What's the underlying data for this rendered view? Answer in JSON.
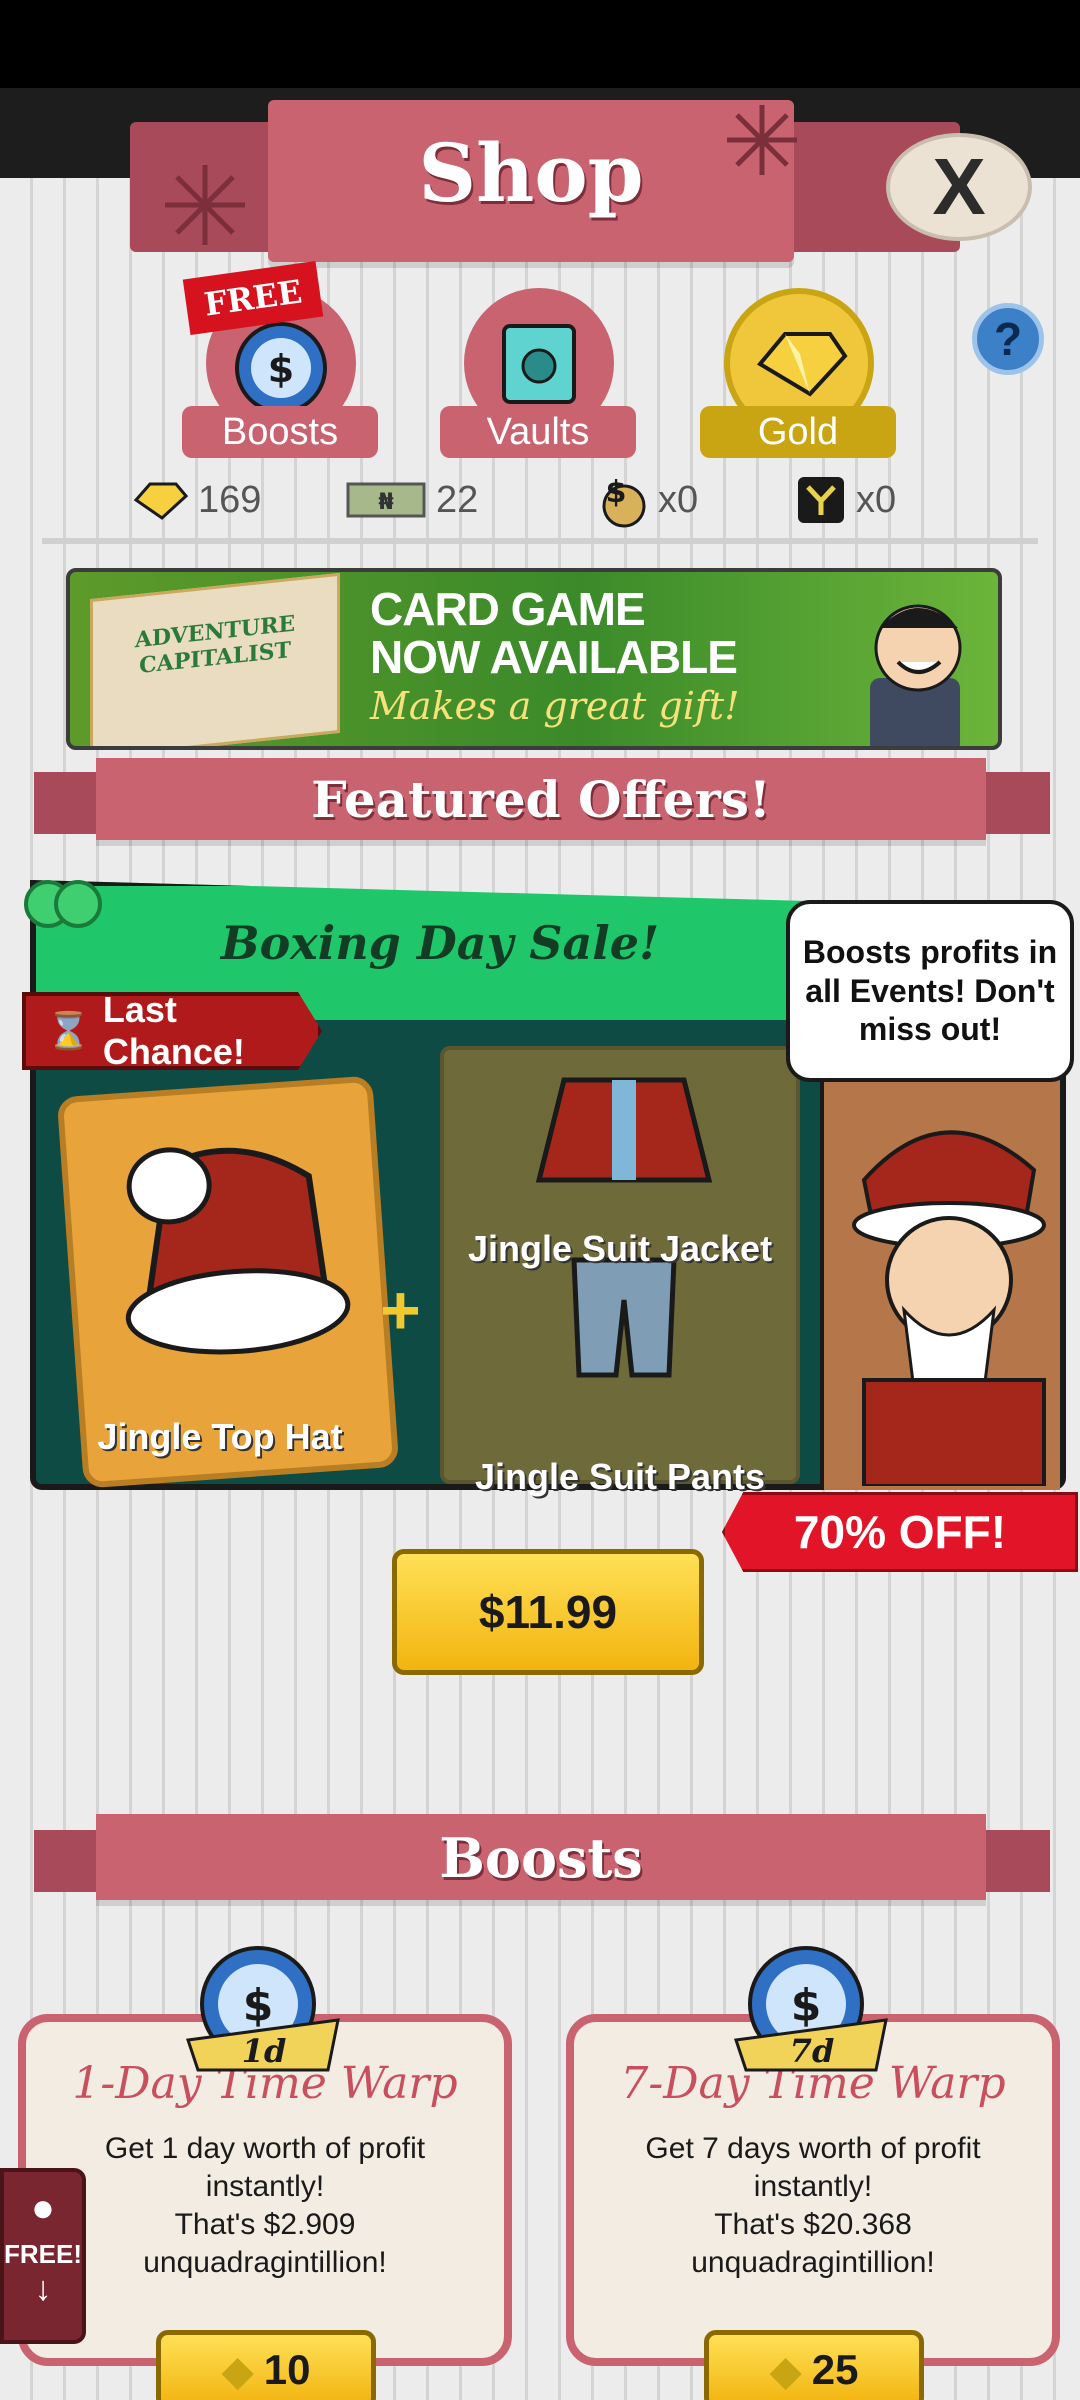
{
  "header": {
    "title": "Shop",
    "close_symbol": "X"
  },
  "categories": [
    {
      "label": "Boosts",
      "badge": "FREE",
      "color": "#c8636f"
    },
    {
      "label": "Vaults",
      "color": "#c8636f"
    },
    {
      "label": "Gold",
      "color": "#c9a514"
    }
  ],
  "help_symbol": "?",
  "currencies": [
    {
      "icon": "gold-gem-icon",
      "value": "169"
    },
    {
      "icon": "megabucks-icon",
      "value": "22"
    },
    {
      "icon": "money-bag-icon",
      "value": "x0"
    },
    {
      "icon": "angel-investor-icon",
      "value": "x0"
    }
  ],
  "ad": {
    "line1": "CARD GAME",
    "line2": "NOW AVAILABLE",
    "line3": "Makes a great gift!",
    "box_title": "ADVENTURE CAPITALIST"
  },
  "featured": {
    "section_title": "Featured Offers!",
    "offer_title": "Boxing Day Sale!",
    "ribbon": "Last Chance!",
    "speech": "Boosts profits in all Events! Don't miss out!",
    "items": [
      "Jingle Top Hat",
      "Jingle Suit Jacket",
      "Jingle Suit Pants"
    ],
    "plus": "+",
    "discount": "70% OFF!",
    "price": "$11.99"
  },
  "boosts": {
    "section_title": "Boosts",
    "cards": [
      {
        "badge": "1d",
        "title": "1-Day Time Warp",
        "desc": [
          "Get 1 day worth of profit",
          "instantly!",
          "That's $2.909",
          "unquadragintillion!"
        ],
        "price": "10"
      },
      {
        "badge": "7d",
        "title": "7-Day Time Warp",
        "desc": [
          "Get 7 days worth of profit",
          "instantly!",
          "That's $20.368",
          "unquadragintillion!"
        ],
        "price": "25"
      }
    ]
  },
  "side_button": {
    "label": "FREE!",
    "arrow": "↓"
  },
  "colors": {
    "banner": "#c8636f",
    "banner_dark": "#a84a5a",
    "gold": "#f2b40f",
    "offer_green": "#1fc76a"
  }
}
